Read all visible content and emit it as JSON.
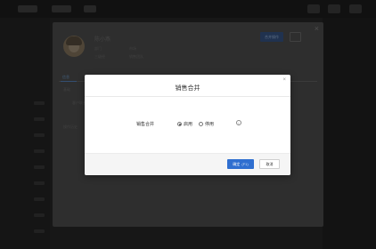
{
  "detail_panel": {
    "contact_name": "陈小燕",
    "meta": [
      {
        "label": "部门",
        "value": "市场"
      },
      {
        "label": "三级经",
        "value": "销售团队"
      }
    ],
    "primary_button_label": "合并操作",
    "tab_label": "信息",
    "sections": [
      "基础",
      "客户联系方式",
      "操作历史"
    ],
    "close_symbol": "×"
  },
  "dialog": {
    "title": "销售合并",
    "close_symbol": "×",
    "field_label": "销售合并",
    "options": [
      {
        "label": "启用",
        "selected": true
      },
      {
        "label": "停用",
        "selected": false
      }
    ],
    "info_icon_symbol": "i",
    "confirm_label": "确定",
    "confirm_shortcut": "(F1)",
    "cancel_label": "取消"
  },
  "colors": {
    "primary": "#2f6fd0",
    "backdrop": "#1b1b1b"
  }
}
